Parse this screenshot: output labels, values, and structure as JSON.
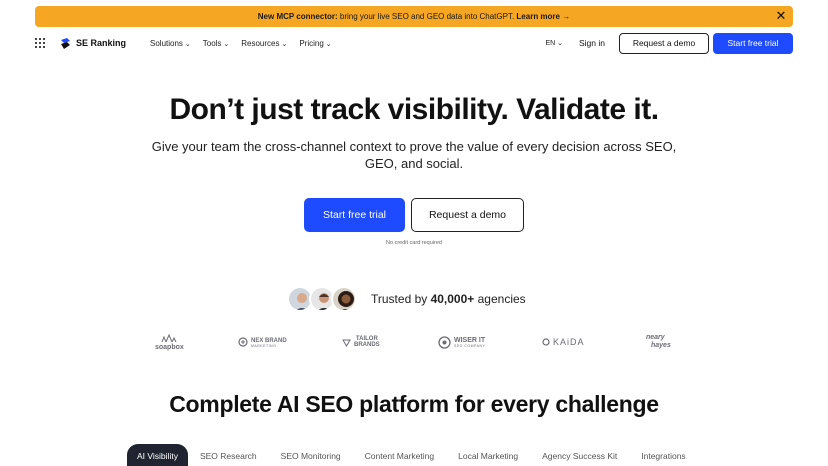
{
  "banner": {
    "bold_text": "New MCP connector:",
    "text": " bring your live SEO and GEO data into ChatGPT. ",
    "link": "Learn more →",
    "close_glyph": "✕"
  },
  "nav": {
    "logo_text": "SE Ranking",
    "menu": [
      "Solutions",
      "Tools",
      "Resources",
      "Pricing"
    ],
    "lang": "EN ⌄",
    "sign_in": "Sign in",
    "request_demo": "Request a demo",
    "start_trial": "Start free trial"
  },
  "hero": {
    "title": "Don’t just track visibility. Validate it.",
    "subtitle": "Give your team the cross-channel context to prove the value of every decision across SEO, GEO, and social.",
    "primary_cta": "Start free trial",
    "secondary_cta": "Request a demo",
    "note": "No credit card required"
  },
  "trusted": {
    "prefix": "Trusted by ",
    "count": "40,000+",
    "suffix": " agencies"
  },
  "brands": {
    "soapbox": "soapbox",
    "nex_brand": "NEX BRAND",
    "nex_brand_sub": "MARKETING",
    "tailor_1": "TAILOR",
    "tailor_2": "BRANDS",
    "wiser": "WISER IT",
    "wiser_sub": "SEO COMPANY",
    "kaida": "KAiDA",
    "neary_1": "neary",
    "neary_2": "hayes"
  },
  "section": {
    "title": "Complete AI SEO platform for every challenge"
  },
  "tabs": [
    "AI Visibility",
    "SEO Research",
    "SEO Monitoring",
    "Content Marketing",
    "Local Marketing",
    "Agency Success Kit",
    "Integrations"
  ],
  "colors": {
    "banner": "#f5a623",
    "primary": "#1e4bff",
    "active_tab": "#1f2430"
  }
}
